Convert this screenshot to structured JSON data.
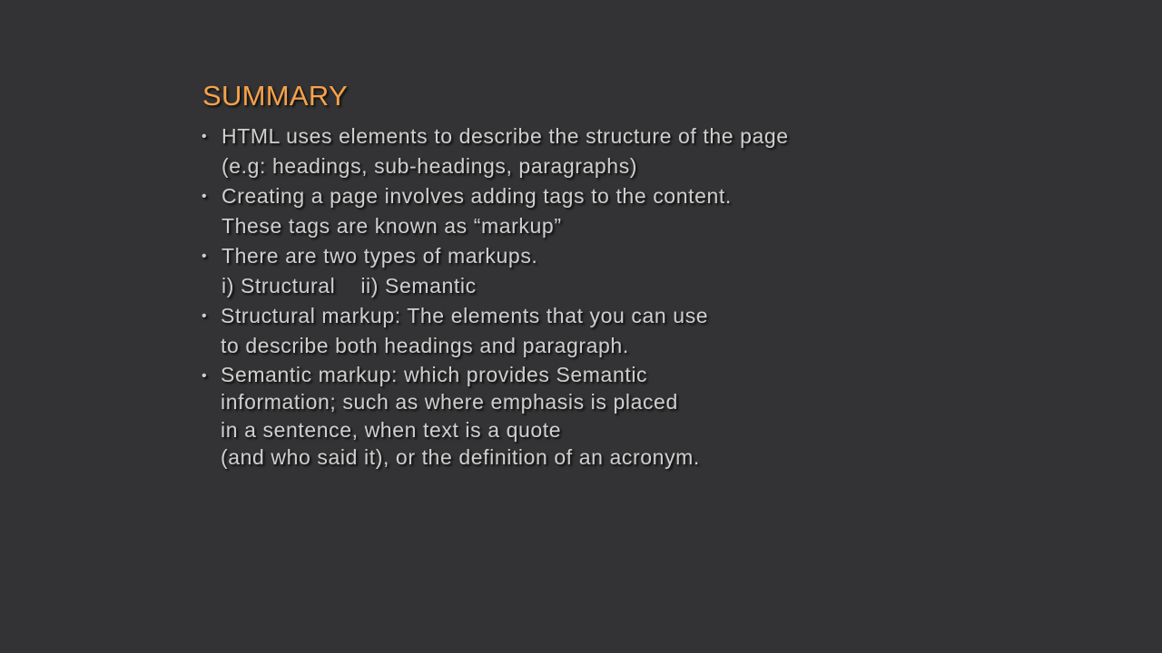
{
  "slide": {
    "title": "SUMMARY",
    "bullets": [
      {
        "bullet_glyph": "•",
        "lines": [
          "HTML uses elements to describe the structure of the page",
          "(e.g: headings, sub-headings, paragraphs)"
        ]
      },
      {
        "bullet_glyph": "•",
        "lines": [
          "Creating a page involves adding tags to the content.",
          "These tags are known as “markup”"
        ]
      },
      {
        "bullet_glyph": "•",
        "lines": [
          "There are two types of markups.",
          "i) Structural    ii) Semantic"
        ]
      },
      {
        "bullet_glyph": "•",
        "lines": [
          "Structural markup: The elements that you can use",
          "to describe both headings and paragraph."
        ]
      },
      {
        "bullet_glyph": "•",
        "lines": [
          "Semantic markup: which provides Semantic",
          "information; such as where emphasis is placed",
          "in a sentence, when text is a quote",
          "(and who said it), or the definition of an acronym."
        ]
      }
    ]
  },
  "colors": {
    "background": "#333234",
    "title": "#f7a24a",
    "text": "#cfcfcf"
  }
}
